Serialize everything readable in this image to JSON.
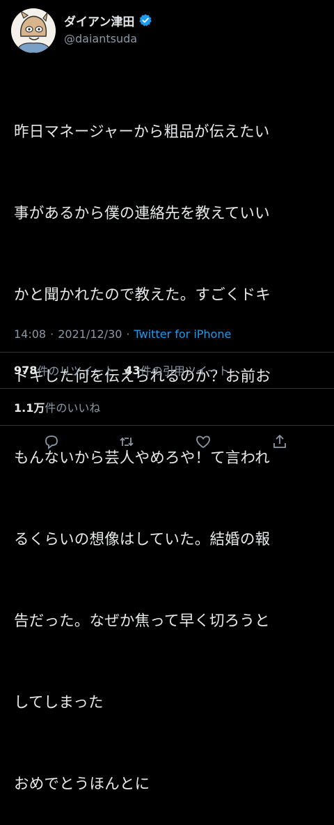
{
  "user": {
    "display_name": "ダイアン津田",
    "handle": "@daiantsuda",
    "avatar_icon": "cartoon-avatar-icon",
    "verified_icon": "verified-badge-icon"
  },
  "tweet": {
    "lines": [
      "昨日マネージャーから粗品が伝えたい",
      "事があるから僕の連絡先を教えていい",
      "かと聞かれたので教えた。すごくドキ",
      "ドキした何を伝えられるのか？お前お",
      "もんないから芸人やめろや！て言われ",
      "るくらいの想像はしていた。結婚の報",
      "告だった。なぜか焦って早く切ろうと",
      "してしまった",
      "おめでとうほんとに"
    ]
  },
  "meta": {
    "time": "14:08",
    "separator": "·",
    "date": "2021/12/30",
    "source": "Twitter for iPhone"
  },
  "stats": {
    "retweets_count": "978",
    "retweets_label": "件のリツイート",
    "quotes_count": "43",
    "quotes_label": "件の引用ツイート",
    "likes_count": "1.1万",
    "likes_label": "件のいいね"
  },
  "actions": [
    "reply-icon",
    "retweet-icon",
    "like-icon",
    "share-icon"
  ],
  "colors": {
    "background": "#000000",
    "text": "#e7e9ea",
    "secondary": "#8b98a5",
    "accent": "#1d9bf0"
  }
}
